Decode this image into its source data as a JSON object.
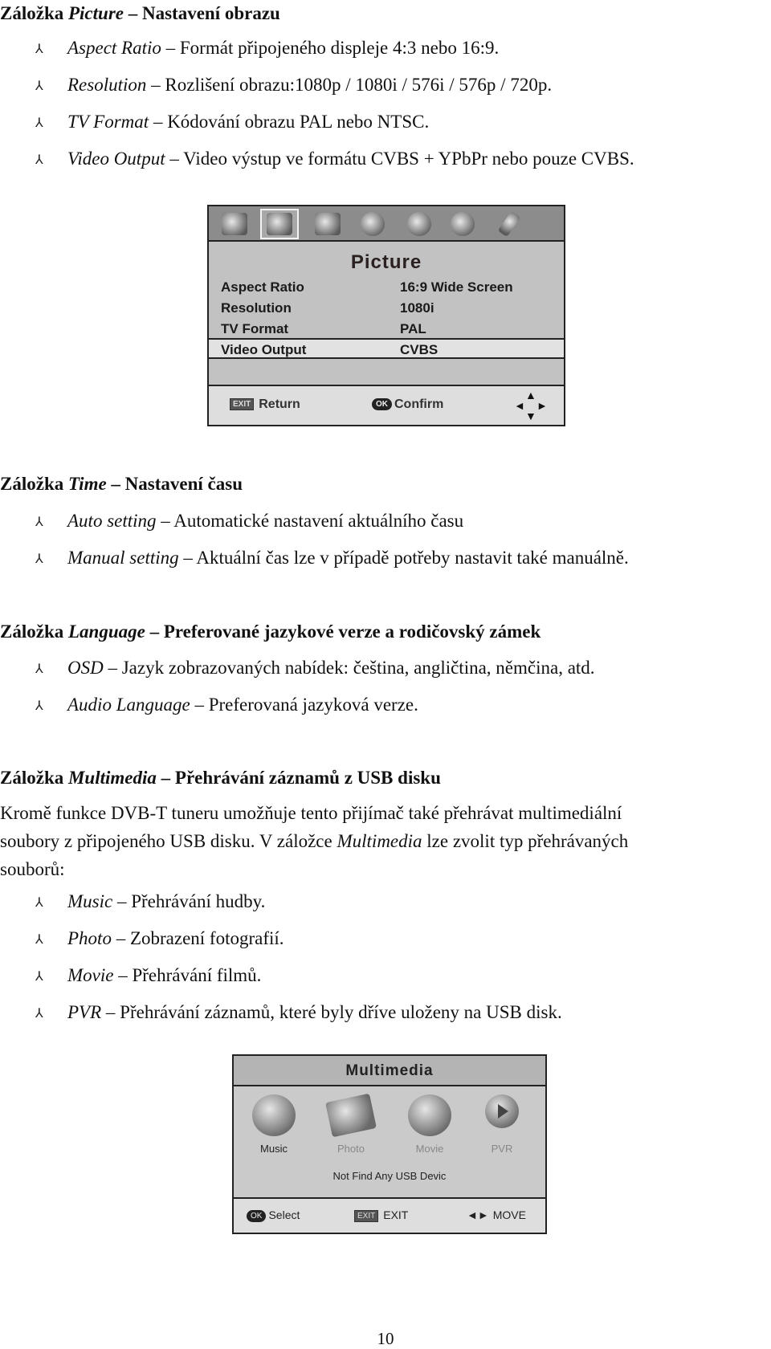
{
  "sections": {
    "picture": {
      "heading_prefix": "Záložka ",
      "heading_term": "Picture",
      "heading_suffix": " – Nastavení obrazu",
      "bullets": [
        {
          "term": "Aspect Ratio",
          "desc": " – Formát připojeného displeje 4:3 nebo 16:9."
        },
        {
          "term": "Resolution",
          "desc": " – Rozlišení obrazu:1080p / 1080i / 576i / 576p / 720p."
        },
        {
          "term": "TV Format",
          "desc": " – Kódování obrazu PAL nebo NTSC."
        },
        {
          "term": "Video Output",
          "desc": " – Video výstup ve formátu CVBS + YPbPr nebo pouze CVBS."
        }
      ]
    },
    "time": {
      "heading_prefix": "Záložka ",
      "heading_term": "Time",
      "heading_suffix": " – Nastavení času",
      "bullets": [
        {
          "term": "Auto setting",
          "desc": " – Automatické nastavení aktuálního času"
        },
        {
          "term": "Manual setting",
          "desc": " – Aktuální čas lze v případě potřeby nastavit také manuálně."
        }
      ]
    },
    "language": {
      "heading_prefix": "Záložka ",
      "heading_term": "Language",
      "heading_suffix": " – Preferované jazykové verze a rodičovský zámek",
      "bullets": [
        {
          "term": "OSD",
          "desc": " – Jazyk zobrazovaných nabídek: čeština, angličtina, němčina, atd."
        },
        {
          "term": "Audio Language",
          "desc": " – Preferovaná jazyková verze."
        }
      ]
    },
    "multimedia": {
      "heading_prefix": "Záložka ",
      "heading_term": "Multimedia",
      "heading_suffix": " – Přehrávání záznamů z USB disku",
      "paragraph_line1": "Kromě funkce DVB-T tuneru umožňuje tento přijímač také přehrávat multimediální",
      "paragraph_line2_a": "soubory z připojeného USB disku. V záložce ",
      "paragraph_line2_term": "Multimedia",
      "paragraph_line2_b": " lze zvolit typ přehrávaných",
      "paragraph_line3": "souborů:",
      "bullets": [
        {
          "term": "Music",
          "desc": " – Přehrávání hudby."
        },
        {
          "term": "Photo",
          "desc": " – Zobrazení fotografií."
        },
        {
          "term": "Movie",
          "desc": " – Přehrávání filmů."
        },
        {
          "term": "PVR",
          "desc": " – Přehrávání záznamů, které byly dříve uloženy na USB disk."
        }
      ]
    }
  },
  "bullet_icon": "⅄",
  "picture_osd": {
    "tabs": [
      "tv-program-icon",
      "picture-icon",
      "search-icon",
      "time-icon",
      "tools-icon",
      "settings-icon",
      "usb-icon"
    ],
    "active_tab": 1,
    "title": "Picture",
    "rows": [
      {
        "label": "Aspect Ratio",
        "value": "16:9 Wide Screen"
      },
      {
        "label": "Resolution",
        "value": "1080i"
      },
      {
        "label": "TV Format",
        "value": "PAL"
      },
      {
        "label": "Video Output",
        "value": "CVBS"
      }
    ],
    "selected_row": 3,
    "footer": {
      "exit_badge": "EXIT",
      "return_label": "Return",
      "ok_badge": "OK",
      "confirm_label": "Confirm"
    }
  },
  "multimedia_osd": {
    "title": "Multimedia",
    "items": [
      {
        "label": "Music",
        "active": true
      },
      {
        "label": "Photo",
        "active": false
      },
      {
        "label": "Movie",
        "active": false
      },
      {
        "label": "PVR",
        "active": false
      }
    ],
    "status": "Not Find Any USB Devic",
    "footer": {
      "ok_badge": "OK",
      "select_label": "Select",
      "exit_badge": "EXIT",
      "exit_label": "EXIT",
      "move_arrows": "◄►",
      "move_label": "MOVE"
    }
  },
  "page_number": "10"
}
